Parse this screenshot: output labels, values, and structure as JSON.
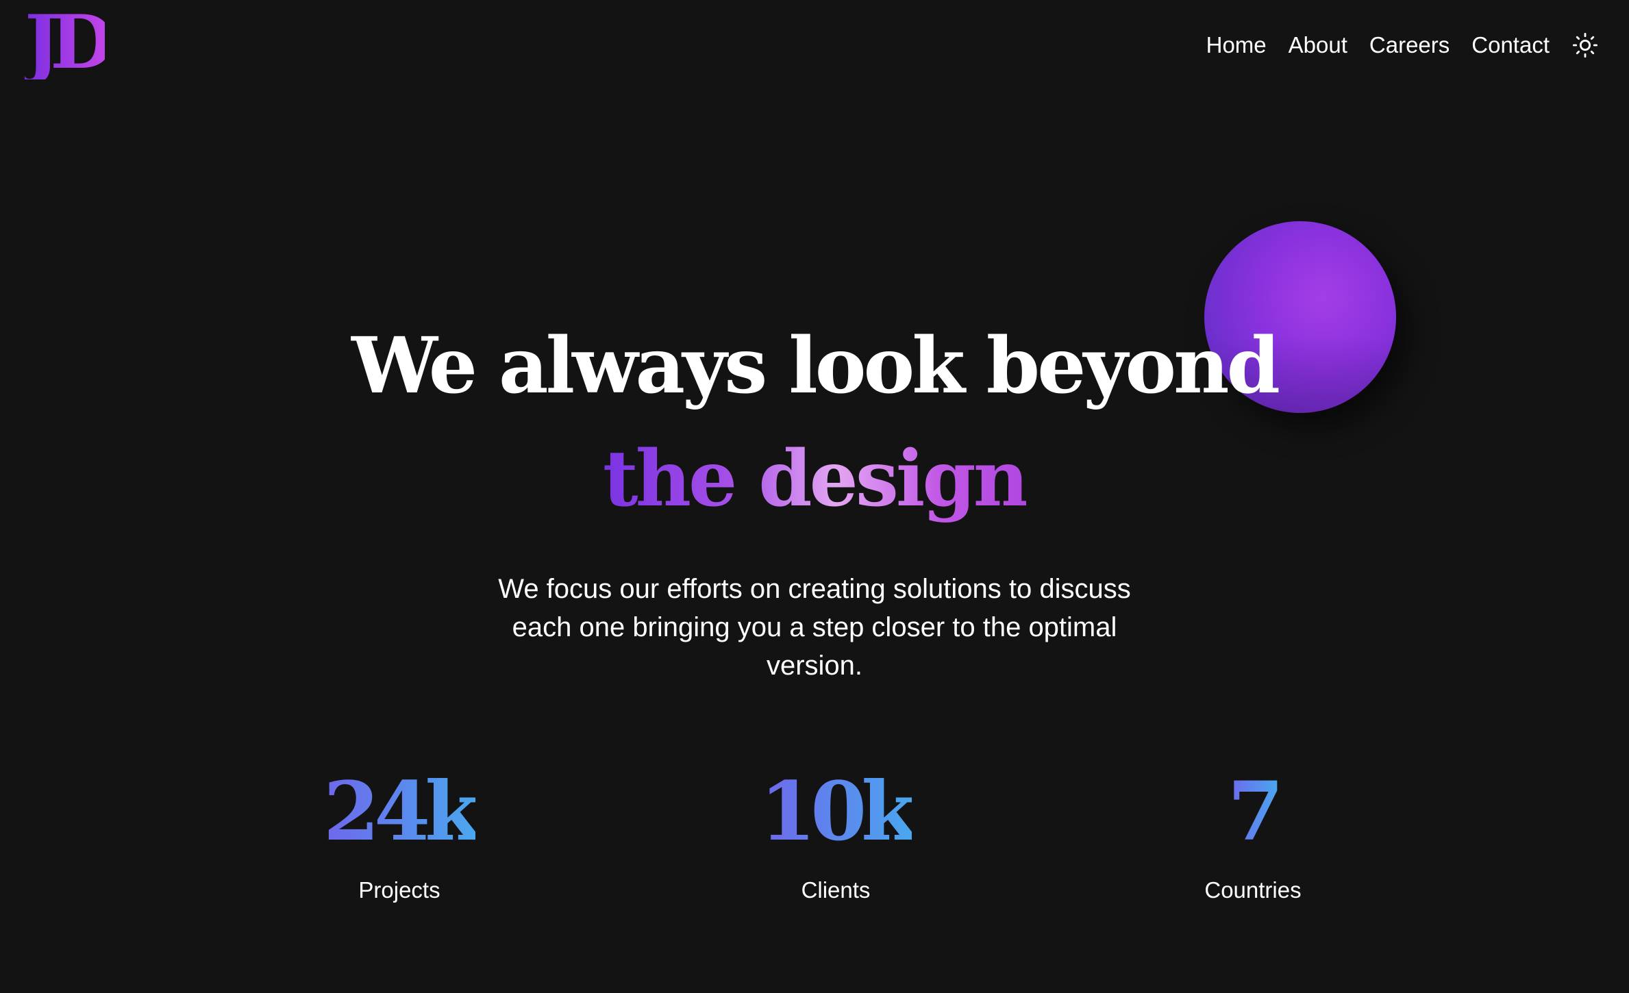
{
  "brand": {
    "logo_text": "JD"
  },
  "nav": {
    "items": [
      "Home",
      "About",
      "Careers",
      "Contact"
    ],
    "theme_toggle_icon": "sun-icon"
  },
  "hero": {
    "headline_line1": "We always look beyond",
    "headline_line2": "the design",
    "subtext": "We focus our efforts on creating solutions to discuss each one bringing you a step closer to the optimal version."
  },
  "stats": [
    {
      "value": "24k",
      "label": "Projects"
    },
    {
      "value": "10k",
      "label": "Clients"
    },
    {
      "value": "7",
      "label": "Countries"
    }
  ],
  "colors": {
    "background": "#131313",
    "text": "#ffffff",
    "accent_purple": "#8a32de",
    "accent_pink": "#c145e8",
    "accent_blue": "#4aa7ee"
  }
}
